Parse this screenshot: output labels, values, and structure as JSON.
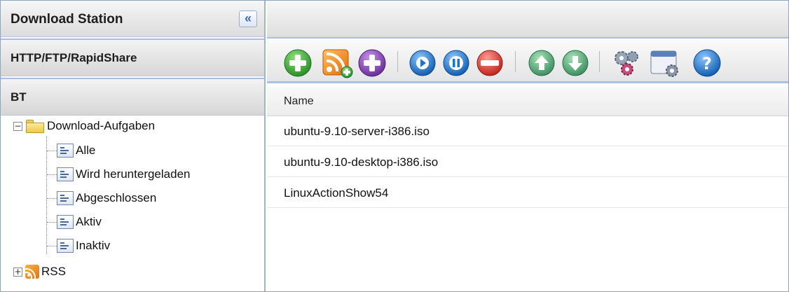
{
  "sidebar": {
    "title": "Download Station",
    "collapse_glyph": "«",
    "sections": [
      {
        "label": "HTTP/FTP/RapidShare"
      },
      {
        "label": "BT"
      }
    ],
    "tree": {
      "root_expander": "−",
      "root_label": "Download-Aufgaben",
      "children": [
        {
          "label": "Alle"
        },
        {
          "label": "Wird heruntergeladen"
        },
        {
          "label": "Abgeschlossen"
        },
        {
          "label": "Aktiv"
        },
        {
          "label": "Inaktiv"
        }
      ],
      "rss_expander": "+",
      "rss_label": "RSS"
    }
  },
  "toolbar": {
    "icons": [
      "add-icon",
      "rss-add-icon",
      "add-purple-icon",
      "play-icon",
      "pause-icon",
      "stop-icon",
      "up-icon",
      "down-icon",
      "settings-gears-icon",
      "window-settings-icon",
      "help-icon"
    ],
    "colors": {
      "green": "#3aa33a",
      "orange": "#f08a1c",
      "purple": "#7b3fa8",
      "blue": "#1f74c6",
      "red": "#d8332a",
      "teal": "#4aa37a",
      "gray": "#8a96a8"
    }
  },
  "list": {
    "column_header": "Name",
    "rows": [
      {
        "name": "ubuntu-9.10-server-i386.iso"
      },
      {
        "name": "ubuntu-9.10-desktop-i386.iso"
      },
      {
        "name": "LinuxActionShow54"
      }
    ]
  }
}
